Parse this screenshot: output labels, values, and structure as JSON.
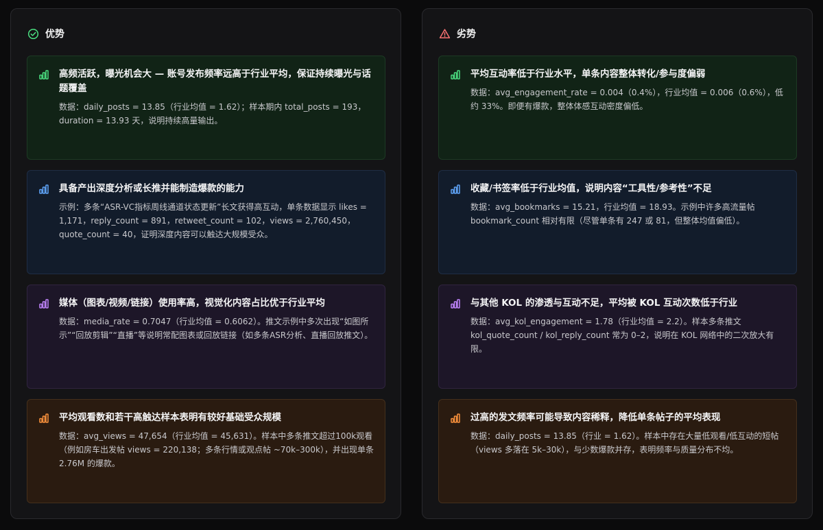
{
  "strengths": {
    "title": "优势",
    "icon": "check-circle-icon",
    "icon_color": "#4ade80",
    "cards": [
      {
        "color": "green",
        "icon": "bar-chart-icon",
        "title": "高频活跃，曝光机会大 — 账号发布频率远高于行业平均，保证持续曝光与话题覆盖",
        "body": "数据：daily_posts = 13.85（行业均值 = 1.62）；样本期内 total_posts = 193，duration = 13.93 天，说明持续高量输出。"
      },
      {
        "color": "blue",
        "icon": "bar-chart-icon",
        "title": "具备产出深度分析或长推并能制造爆款的能力",
        "body": "示例：多条“ASR-VC指标周线通道状态更新”长文获得高互动，单条数据显示 likes = 1,171，reply_count = 891，retweet_count = 102，views = 2,760,450，quote_count = 40，证明深度内容可以触达大规模受众。"
      },
      {
        "color": "purple",
        "icon": "bar-chart-icon",
        "title": "媒体（图表/视频/链接）使用率高，视觉化内容占比优于行业平均",
        "body": "数据：media_rate = 0.7047（行业均值 = 0.6062）。推文示例中多次出现“如图所示”“回放剪辑”“直播”等说明常配图表或回放链接（如多条ASR分析、直播回放推文）。"
      },
      {
        "color": "orange",
        "icon": "bar-chart-icon",
        "title": "平均观看数和若干高触达样本表明有较好基础受众规模",
        "body": "数据：avg_views = 47,654（行业均值 = 45,631）。样本中多条推文超过100k观看（例如房车出发帖 views = 220,138；多条行情或观点帖 ~70k–300k），并出现单条 2.76M 的爆款。"
      }
    ]
  },
  "weaknesses": {
    "title": "劣势",
    "icon": "warning-triangle-icon",
    "icon_color": "#f87171",
    "cards": [
      {
        "color": "green",
        "icon": "bar-chart-icon",
        "title": "平均互动率低于行业水平，单条内容整体转化/参与度偏弱",
        "body": "数据：avg_engagement_rate = 0.004（0.4%），行业均值 = 0.006（0.6%），低约 33%。即便有爆款，整体体感互动密度偏低。"
      },
      {
        "color": "blue",
        "icon": "bar-chart-icon",
        "title": "收藏/书签率低于行业均值，说明内容“工具性/参考性”不足",
        "body": "数据：avg_bookmarks = 15.21，行业均值 = 18.93。示例中许多高流量帖 bookmark_count 相对有限（尽管单条有 247 或 81，但整体均值偏低）。"
      },
      {
        "color": "purple",
        "icon": "bar-chart-icon",
        "title": "与其他 KOL 的渗透与互动不足，平均被 KOL 互动次数低于行业",
        "body": "数据：avg_kol_engagement = 1.78（行业均值 = 2.2）。样本多条推文 kol_quote_count / kol_reply_count 常为 0–2，说明在 KOL 网络中的二次放大有限。"
      },
      {
        "color": "orange",
        "icon": "bar-chart-icon",
        "title": "过高的发文频率可能导致内容稀释，降低单条帖子的平均表现",
        "body": "数据：daily_posts = 13.85（行业 = 1.62）。样本中存在大量低观看/低互动的短帖（views 多落在 5k–30k），与少数爆款并存，表明频率与质量分布不均。"
      }
    ]
  },
  "accent_colors": {
    "green": "#4ade80",
    "blue": "#60a5fa",
    "purple": "#c084fc",
    "orange": "#fb923c"
  }
}
